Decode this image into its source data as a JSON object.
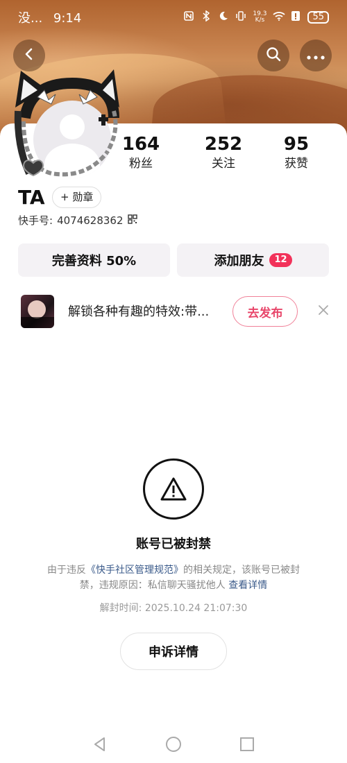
{
  "status_bar": {
    "carrier": "没...",
    "time": "9:14",
    "network_speed_value": "19.3",
    "network_speed_unit": "K/s",
    "battery": "55"
  },
  "header": {
    "back_icon": "chevron-left-icon",
    "search_icon": "search-icon",
    "more_icon": "more-horizontal-icon"
  },
  "profile": {
    "followers_count": "164",
    "followers_label": "粉丝",
    "following_count": "252",
    "following_label": "关注",
    "likes_count": "95",
    "likes_label": "获赞",
    "username": "TA",
    "badge_label": "+ 勋章",
    "uid_label": "快手号:",
    "uid_value": "4074628362"
  },
  "actions": {
    "complete_profile": "完善资料 50%",
    "add_friends": "添加朋友",
    "add_friends_count": "12"
  },
  "promo": {
    "text": "解锁各种有趣的特效:带...",
    "publish_label": "去发布",
    "close_icon": "close-icon"
  },
  "ban": {
    "title": "账号已被封禁",
    "desc_prefix": "由于违反",
    "desc_link": "《快手社区管理规范》",
    "desc_middle": "的相关规定，该账号已被封禁，违规原因：私信聊天骚扰他人",
    "desc_detail": "查看详情",
    "unban_label": "解封时间:",
    "unban_time": "2025.10.24 21:07:30",
    "appeal_label": "申诉详情"
  },
  "colors": {
    "accent_pink": "#e8466a",
    "badge_red": "#f2325a",
    "link_blue": "#3a5a8a"
  }
}
